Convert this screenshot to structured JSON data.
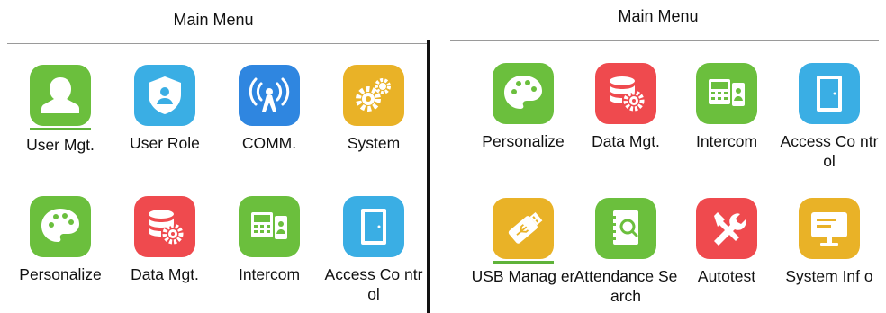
{
  "left_panel": {
    "title": "Main Menu",
    "items": [
      {
        "label": "User Mgt.",
        "icon": "user-icon",
        "color": "#6bbf3d"
      },
      {
        "label": "User Role",
        "icon": "shield-user-icon",
        "color": "#3aaee4"
      },
      {
        "label": "COMM.",
        "icon": "antenna-icon",
        "color": "#2f86e0"
      },
      {
        "label": "System",
        "icon": "gears-icon",
        "color": "#e9b227"
      },
      {
        "label": "Personalize",
        "icon": "palette-icon",
        "color": "#6bbf3d"
      },
      {
        "label": "Data Mgt.",
        "icon": "database-gear-icon",
        "color": "#ef4a4e"
      },
      {
        "label": "Intercom",
        "icon": "intercom-icon",
        "color": "#6bbf3d"
      },
      {
        "label": "Access Co ntrol",
        "icon": "door-icon",
        "color": "#3aaee4"
      }
    ]
  },
  "right_panel": {
    "title": "Main Menu",
    "items": [
      {
        "label": "Personalize",
        "icon": "palette-icon",
        "color": "#6bbf3d"
      },
      {
        "label": "Data Mgt.",
        "icon": "database-gear-icon",
        "color": "#ef4a4e"
      },
      {
        "label": "Intercom",
        "icon": "intercom-icon",
        "color": "#6bbf3d"
      },
      {
        "label": "Access Co ntrol",
        "icon": "door-icon",
        "color": "#3aaee4"
      },
      {
        "label": "USB Manag er",
        "icon": "usb-icon",
        "color": "#e9b227"
      },
      {
        "label": "Attendance Search",
        "icon": "address-book-search-icon",
        "color": "#6bbf3d"
      },
      {
        "label": "Autotest",
        "icon": "tools-icon",
        "color": "#ef4a4e"
      },
      {
        "label": "System Inf o",
        "icon": "monitor-icon",
        "color": "#e9b227"
      }
    ]
  }
}
